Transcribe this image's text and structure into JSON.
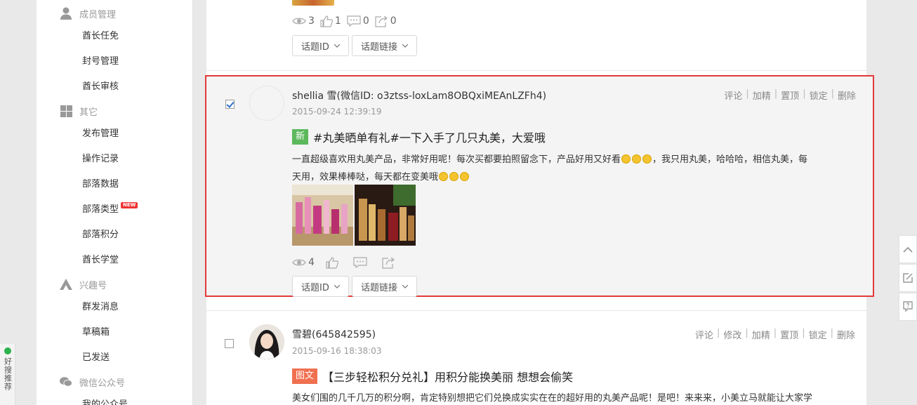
{
  "sidebar": {
    "sections": [
      {
        "label": "成员管理",
        "icon": "user-icon"
      },
      {
        "label": "其它",
        "icon": "grid-icon"
      },
      {
        "label": "兴趣号",
        "icon": "interest-icon"
      },
      {
        "label": "微信公众号",
        "icon": "wechat-icon"
      }
    ],
    "items": [
      "酋长任免",
      "封号管理",
      "酋长审核",
      "发布管理",
      "操作记录",
      "部落数据",
      "部落类型",
      "部落积分",
      "酋长学堂",
      "群发消息",
      "草稿箱",
      "已发送",
      "我的公众号"
    ],
    "new_badge": "NEW"
  },
  "post_prev": {
    "views": "3",
    "likes": "1",
    "comments": "0",
    "shares": "0",
    "topic_id_label": "话题ID",
    "topic_link_label": "话题链接"
  },
  "post1": {
    "checked": true,
    "user": "shellia 雪(微信ID: o3ztss-loxLam8OBQxiMEAnLZFh4)",
    "time": "2015-09-24 12:39:19",
    "tag": "新",
    "tag_color": "#5cb85c",
    "title": "#丸美晒单有礼#一下入手了几只丸美，大爱哦",
    "content_a": "一直超级喜欢用丸美产品，非常好用呢！每次买都要拍照留念下，产品好用又好看",
    "content_b": "，我只用丸美，哈哈哈，相信丸美，每",
    "content_c": "天用，效果棒棒哒，每天都在变美哦",
    "views": "4",
    "actions": [
      "评论",
      "加精",
      "置顶",
      "锁定",
      "删除"
    ],
    "topic_id_label": "话题ID",
    "topic_link_label": "话题链接"
  },
  "post2": {
    "checked": false,
    "user": "雪碧(645842595)",
    "time": "2015-09-16 18:38:03",
    "tag": "图文",
    "tag_color": "#f07050",
    "title": "【三步轻松积分兑礼】用积分能换美丽 想想会偷笑",
    "content": "美女们围的几千几万的积分啊，肯定特别想把它们兑换成实实在在的超好用的丸美产品呢！是吧！来来来，小美立马就能让大家学",
    "actions": [
      "评论",
      "修改",
      "加精",
      "置顶",
      "锁定",
      "删除"
    ]
  },
  "haosou": {
    "label": "好搜推荐"
  }
}
